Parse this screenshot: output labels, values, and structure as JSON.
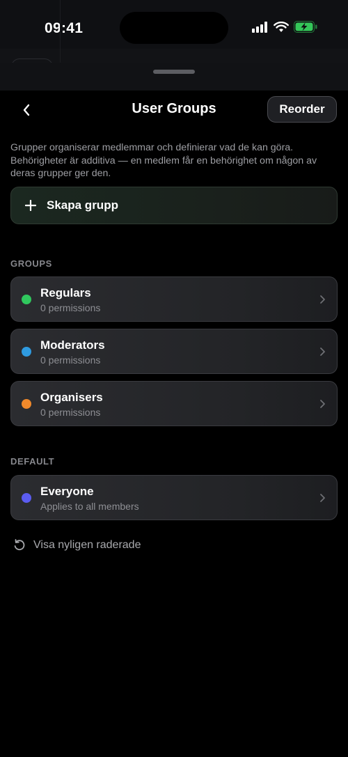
{
  "status_bar": {
    "time": "09:41",
    "icons": [
      "signal-icon",
      "wifi-icon",
      "battery-charging-icon"
    ],
    "battery_color": "#34c759"
  },
  "header": {
    "back_icon": "chevron-left-icon",
    "title": "User Groups",
    "reorder_label": "Reorder"
  },
  "description": "Grupper organiserar medlemmar och definierar vad de kan göra. Behörigheter är additiva — en medlem får en behörighet om någon av deras grupper ger den.",
  "create_button": {
    "icon": "plus-icon",
    "label": "Skapa grupp"
  },
  "sections": {
    "groups_label": "GROUPS",
    "default_label": "DEFAULT"
  },
  "groups": [
    {
      "name": "Regulars",
      "subtitle": "0 permissions",
      "color": "#30c85e"
    },
    {
      "name": "Moderators",
      "subtitle": "0 permissions",
      "color": "#2f9be0"
    },
    {
      "name": "Organisers",
      "subtitle": "0 permissions",
      "color": "#f0892b"
    }
  ],
  "default_group": {
    "name": "Everyone",
    "subtitle": "Applies to all members",
    "color": "#5b5cf0"
  },
  "recently_deleted": {
    "icon": "restore-icon",
    "label": "Visa nyligen raderade"
  }
}
